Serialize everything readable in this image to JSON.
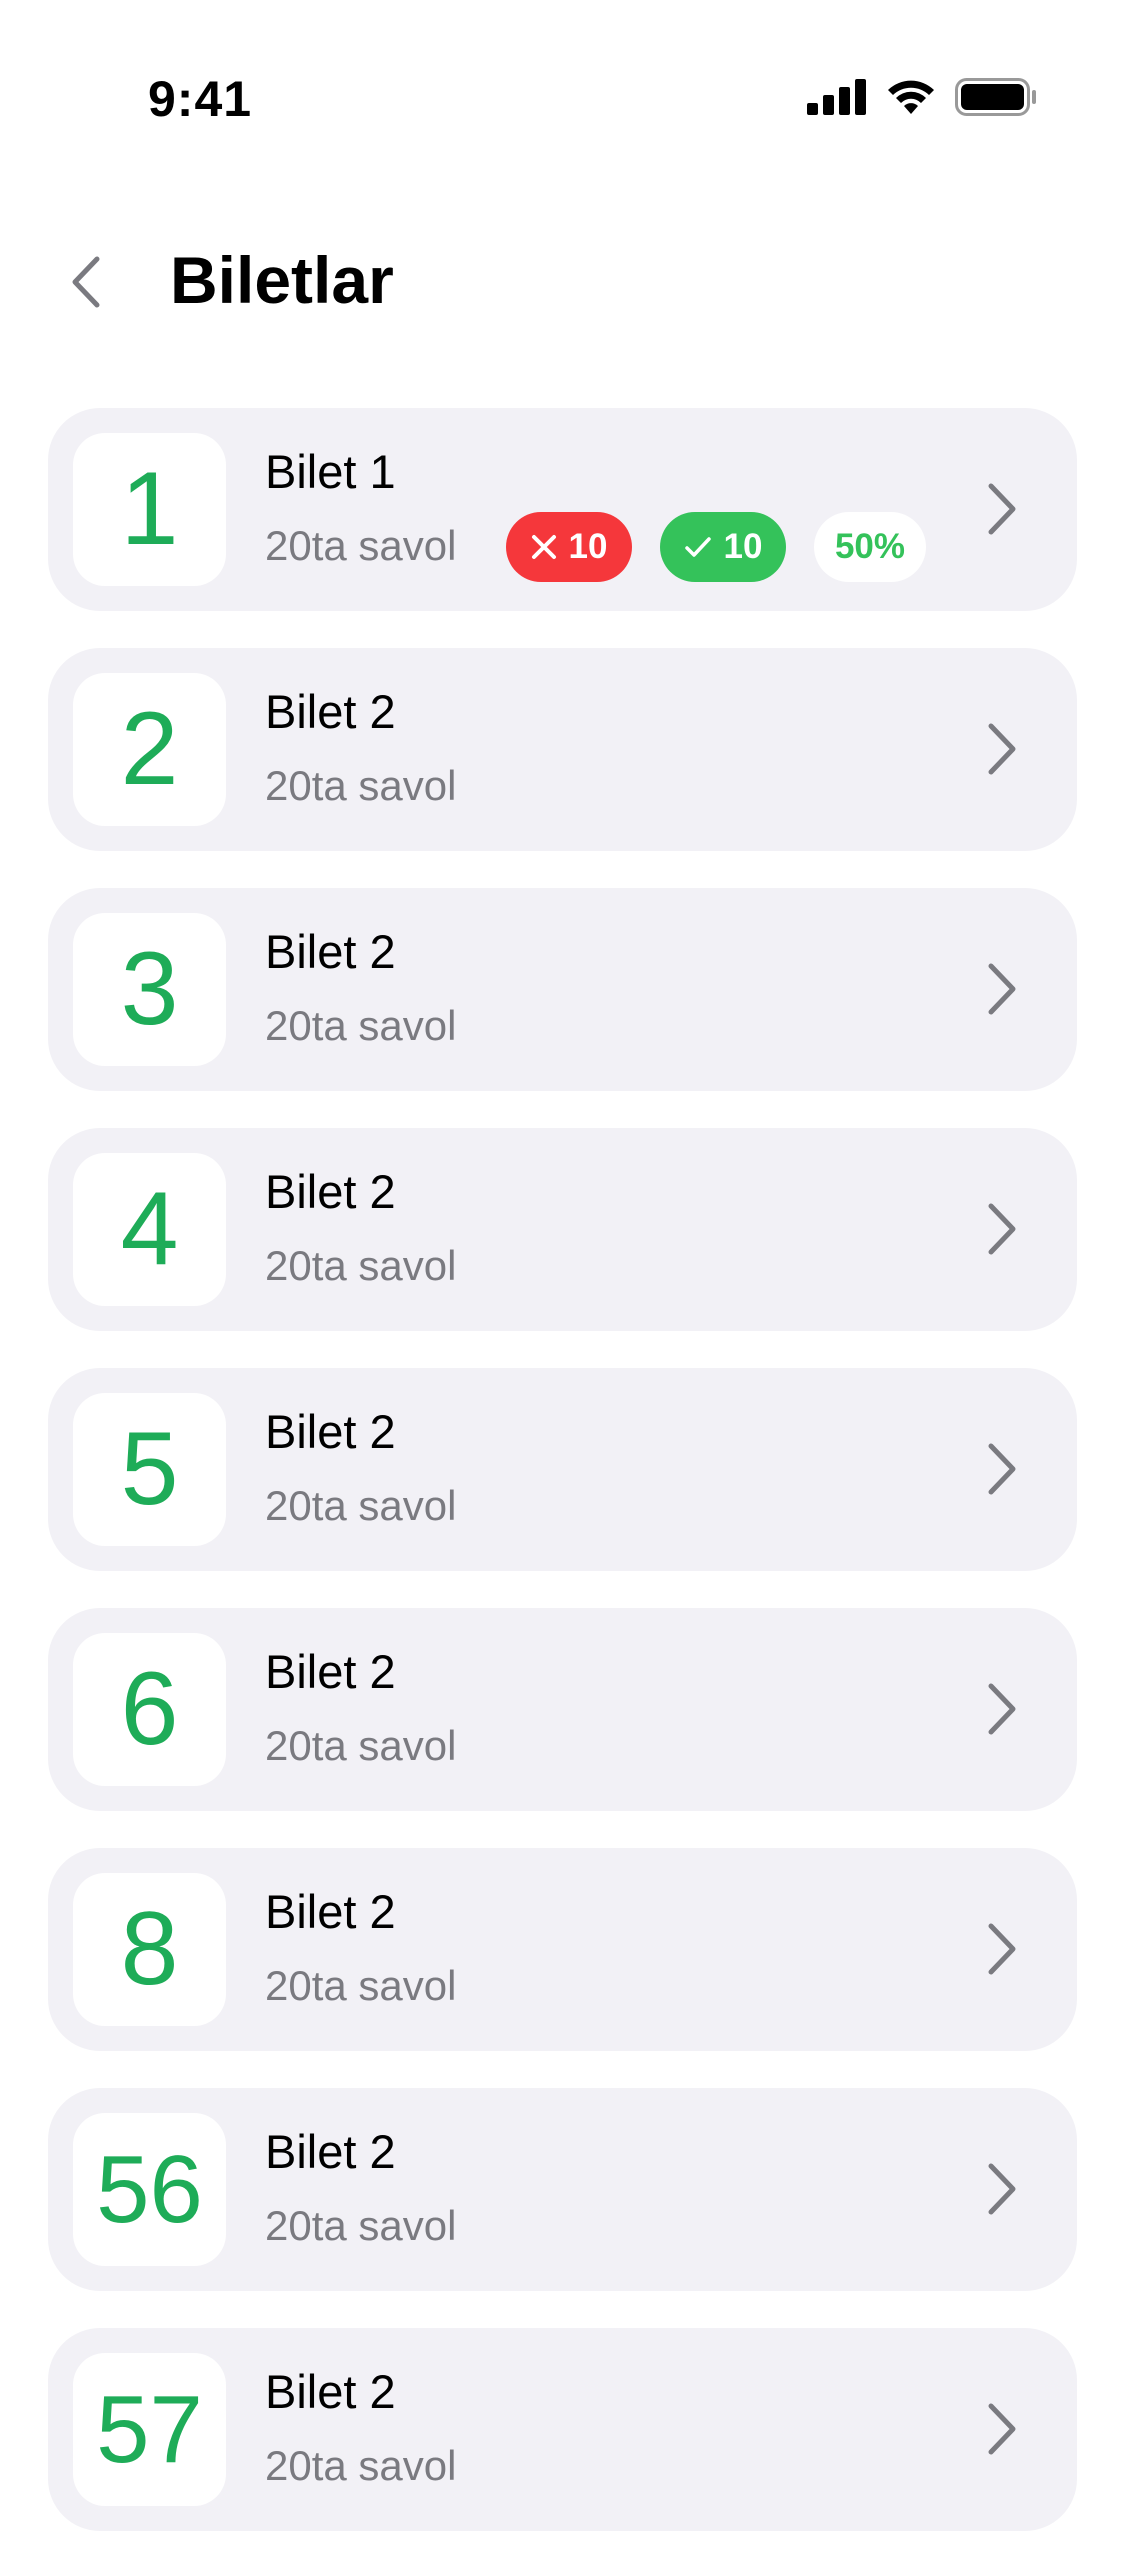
{
  "status_bar": {
    "time": "9:41"
  },
  "header": {
    "title": "Biletlar"
  },
  "tickets": [
    {
      "number": "1",
      "title": "Bilet 1",
      "subtitle": "20ta savol",
      "wrong": "10",
      "correct": "10",
      "percent": "50%"
    },
    {
      "number": "2",
      "title": "Bilet 2",
      "subtitle": "20ta savol"
    },
    {
      "number": "3",
      "title": "Bilet 2",
      "subtitle": "20ta savol"
    },
    {
      "number": "4",
      "title": "Bilet 2",
      "subtitle": "20ta savol"
    },
    {
      "number": "5",
      "title": "Bilet 2",
      "subtitle": "20ta savol"
    },
    {
      "number": "6",
      "title": "Bilet 2",
      "subtitle": "20ta savol"
    },
    {
      "number": "8",
      "title": "Bilet 2",
      "subtitle": "20ta savol"
    },
    {
      "number": "56",
      "title": "Bilet 2",
      "subtitle": "20ta savol"
    },
    {
      "number": "57",
      "title": "Bilet 2",
      "subtitle": "20ta savol"
    }
  ],
  "colors": {
    "accent_green": "#1eac58",
    "wrong_red": "#f5373b",
    "correct_green": "#34c25a",
    "card_bg": "#f2f1f6"
  },
  "icons": {
    "back": "chevron-left-icon",
    "row_arrow": "chevron-right-icon",
    "wrong": "x-icon",
    "correct": "check-icon"
  }
}
